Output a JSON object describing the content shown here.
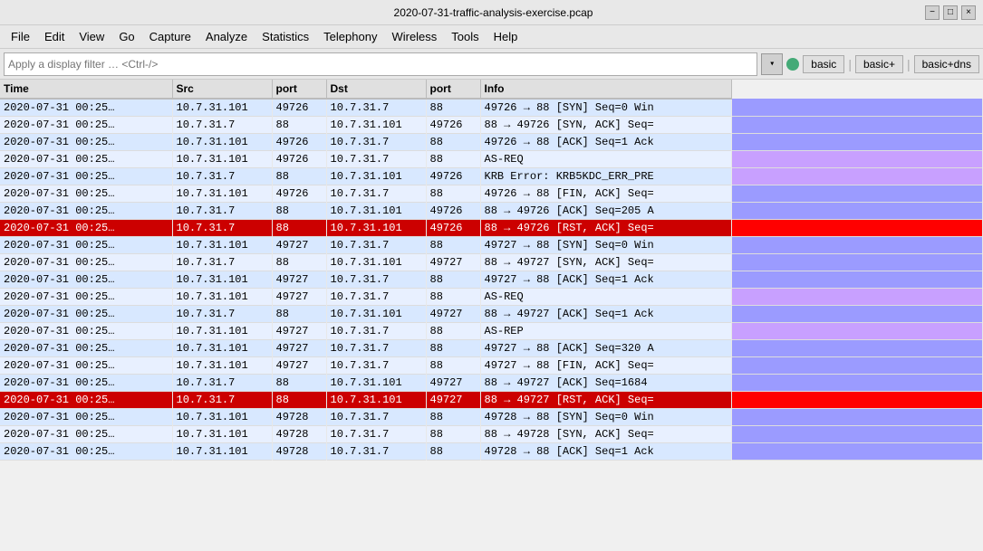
{
  "titleBar": {
    "title": "2020-07-31-traffic-analysis-exercise.pcap",
    "minBtn": "−",
    "maxBtn": "□",
    "closeBtn": "×"
  },
  "menuBar": {
    "items": [
      {
        "label": "File",
        "underline": 0
      },
      {
        "label": "Edit",
        "underline": 0
      },
      {
        "label": "View",
        "underline": 0
      },
      {
        "label": "Go",
        "underline": 0
      },
      {
        "label": "Capture",
        "underline": 0
      },
      {
        "label": "Analyze",
        "underline": 0
      },
      {
        "label": "Statistics",
        "underline": 0
      },
      {
        "label": "Telephony",
        "underline": 0
      },
      {
        "label": "Wireless",
        "underline": 0
      },
      {
        "label": "Tools",
        "underline": 0
      },
      {
        "label": "Help",
        "underline": 0
      }
    ]
  },
  "filterBar": {
    "placeholder": "Apply a display filter … <Ctrl-/>",
    "arrowLabel": "▼",
    "presets": [
      "basic",
      "basic+",
      "basic+dns"
    ]
  },
  "table": {
    "columns": [
      "Time",
      "Src",
      "port",
      "Dst",
      "port",
      "Info"
    ],
    "rows": [
      {
        "time": "2020-07-31  00:25…",
        "src": "10.7.31.101",
        "sport": "49726",
        "dst": "10.7.31.7",
        "dport": "88",
        "info": "49726 → 88  [SYN]  Seq=0 Win",
        "style": "odd",
        "strip": "#9b9bff"
      },
      {
        "time": "2020-07-31  00:25…",
        "src": "10.7.31.7",
        "sport": "88",
        "dst": "10.7.31.101",
        "dport": "49726",
        "info": "88 → 49726  [SYN, ACK]  Seq=",
        "style": "even",
        "strip": "#9b9bff"
      },
      {
        "time": "2020-07-31  00:25…",
        "src": "10.7.31.101",
        "sport": "49726",
        "dst": "10.7.31.7",
        "dport": "88",
        "info": "49726 → 88  [ACK]  Seq=1 Ack",
        "style": "odd",
        "strip": "#9b9bff"
      },
      {
        "time": "2020-07-31  00:25…",
        "src": "10.7.31.101",
        "sport": "49726",
        "dst": "10.7.31.7",
        "dport": "88",
        "info": "AS-REQ",
        "style": "even",
        "strip": "#c8a0ff"
      },
      {
        "time": "2020-07-31  00:25…",
        "src": "10.7.31.7",
        "sport": "88",
        "dst": "10.7.31.101",
        "dport": "49726",
        "info": "KRB Error:  KRB5KDC_ERR_PRE",
        "style": "odd",
        "strip": "#c8a0ff"
      },
      {
        "time": "2020-07-31  00:25…",
        "src": "10.7.31.101",
        "sport": "49726",
        "dst": "10.7.31.7",
        "dport": "88",
        "info": "49726 → 88  [FIN, ACK]  Seq=",
        "style": "even",
        "strip": "#9b9bff"
      },
      {
        "time": "2020-07-31  00:25…",
        "src": "10.7.31.7",
        "sport": "88",
        "dst": "10.7.31.101",
        "dport": "49726",
        "info": "88 → 49726  [ACK]  Seq=205 A",
        "style": "odd",
        "strip": "#9b9bff"
      },
      {
        "time": "2020-07-31  00:25…",
        "src": "10.7.31.7",
        "sport": "88",
        "dst": "10.7.31.101",
        "dport": "49726",
        "info": "88 → 49726  [RST, ACK]  Seq=",
        "style": "selected",
        "strip": "#ff0000"
      },
      {
        "time": "2020-07-31  00:25…",
        "src": "10.7.31.101",
        "sport": "49727",
        "dst": "10.7.31.7",
        "dport": "88",
        "info": "49727 → 88  [SYN]  Seq=0 Win",
        "style": "odd",
        "strip": "#9b9bff"
      },
      {
        "time": "2020-07-31  00:25…",
        "src": "10.7.31.7",
        "sport": "88",
        "dst": "10.7.31.101",
        "dport": "49727",
        "info": "88 → 49727  [SYN, ACK]  Seq=",
        "style": "even",
        "strip": "#9b9bff"
      },
      {
        "time": "2020-07-31  00:25…",
        "src": "10.7.31.101",
        "sport": "49727",
        "dst": "10.7.31.7",
        "dport": "88",
        "info": "49727 → 88  [ACK]  Seq=1 Ack",
        "style": "odd",
        "strip": "#9b9bff"
      },
      {
        "time": "2020-07-31  00:25…",
        "src": "10.7.31.101",
        "sport": "49727",
        "dst": "10.7.31.7",
        "dport": "88",
        "info": "AS-REQ",
        "style": "even",
        "strip": "#c8a0ff"
      },
      {
        "time": "2020-07-31  00:25…",
        "src": "10.7.31.7",
        "sport": "88",
        "dst": "10.7.31.101",
        "dport": "49727",
        "info": "88 → 49727  [ACK]  Seq=1 Ack",
        "style": "odd",
        "strip": "#9b9bff"
      },
      {
        "time": "2020-07-31  00:25…",
        "src": "10.7.31.101",
        "sport": "49727",
        "dst": "10.7.31.7",
        "dport": "88",
        "info": "AS-REP",
        "style": "even",
        "strip": "#c8a0ff"
      },
      {
        "time": "2020-07-31  00:25…",
        "src": "10.7.31.101",
        "sport": "49727",
        "dst": "10.7.31.7",
        "dport": "88",
        "info": "49727 → 88  [ACK]  Seq=320 A",
        "style": "odd",
        "strip": "#9b9bff"
      },
      {
        "time": "2020-07-31  00:25…",
        "src": "10.7.31.101",
        "sport": "49727",
        "dst": "10.7.31.7",
        "dport": "88",
        "info": "49727 → 88  [FIN, ACK]  Seq=",
        "style": "even",
        "strip": "#9b9bff"
      },
      {
        "time": "2020-07-31  00:25…",
        "src": "10.7.31.7",
        "sport": "88",
        "dst": "10.7.31.101",
        "dport": "49727",
        "info": "88 → 49727  [ACK]  Seq=1684",
        "style": "odd",
        "strip": "#9b9bff"
      },
      {
        "time": "2020-07-31  00:25…",
        "src": "10.7.31.7",
        "sport": "88",
        "dst": "10.7.31.101",
        "dport": "49727",
        "info": "88 → 49727  [RST, ACK]  Seq=",
        "style": "selected",
        "strip": "#ff0000"
      },
      {
        "time": "2020-07-31  00:25…",
        "src": "10.7.31.101",
        "sport": "49728",
        "dst": "10.7.31.7",
        "dport": "88",
        "info": "49728 → 88  [SYN]  Seq=0 Win",
        "style": "odd",
        "strip": "#9b9bff"
      },
      {
        "time": "2020-07-31  00:25…",
        "src": "10.7.31.101",
        "sport": "49728",
        "dst": "10.7.31.7",
        "dport": "88",
        "info": "88 → 49728  [SYN, ACK]  Seq=",
        "style": "even",
        "strip": "#9b9bff"
      },
      {
        "time": "2020-07-31  00:25…",
        "src": "10.7.31.101",
        "sport": "49728",
        "dst": "10.7.31.7",
        "dport": "88",
        "info": "49728 → 88  [ACK]  Seq=1 Ack",
        "style": "odd",
        "strip": "#9b9bff"
      }
    ]
  }
}
